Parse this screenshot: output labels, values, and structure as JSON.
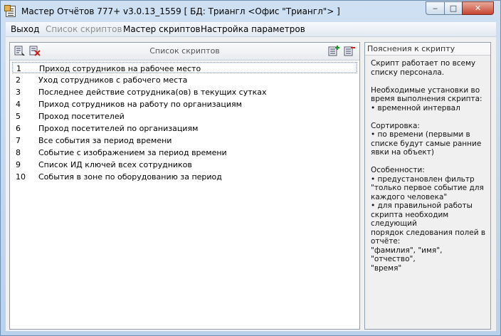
{
  "window": {
    "title": "Мастер Отчётов 777+ v3.0.13_1559 [ БД: Триангл <Офис \"Триангл\"> ]",
    "controls": {
      "minimize": "‒",
      "maximize": "□",
      "close": "✕"
    }
  },
  "menu": [
    {
      "label": "Выход",
      "enabled": true
    },
    {
      "label": "Список скриптов",
      "enabled": false
    },
    {
      "label": "Мастер скриптов",
      "enabled": true
    },
    {
      "label": "Настройка параметров",
      "enabled": true
    }
  ],
  "script_list": {
    "title": "Список скриптов",
    "toolbar_icons": [
      "list-edit-icon",
      "list-delete-icon",
      "add-script-icon",
      "remove-script-icon"
    ],
    "selected_index": 0,
    "items": [
      {
        "num": "1",
        "name": "Приход сотрудников на рабочее место"
      },
      {
        "num": "2",
        "name": "Уход сотрудников с рабочего места"
      },
      {
        "num": "3",
        "name": "Последнее действие сотрудника(ов) в текущих сутках"
      },
      {
        "num": "4",
        "name": "Приход сотрудников на работу по организациям"
      },
      {
        "num": "5",
        "name": "Проход посетителей"
      },
      {
        "num": "6",
        "name": "Проход посетителей по организациям"
      },
      {
        "num": "7",
        "name": "Все события за период времени"
      },
      {
        "num": "8",
        "name": "Событие с изображением за период времени"
      },
      {
        "num": "9",
        "name": "Список ИД ключей всех сотрудников"
      },
      {
        "num": "10",
        "name": "События в зоне по оборудованию за период"
      }
    ]
  },
  "notes_panel": {
    "title": "Пояснения к скрипту",
    "text": "Скрипт работает по всему\nсписку персонала.\n\nНеобходимые установки во\nвремя выполнения скрипта:\n• временной интервал\n\nСортировка:\n• по времени (первыми в\nсписке будут самые ранние\nявки на объект)\n\nОсобенности:\n• предустановлен фильтр\n\"только первое событие для\nкаждого человека\"\n• для правильной работы\nскрипта необходим\nследующий\nпорядок следования полей в\nотчёте:\n\"фамилия\", \"имя\", \"отчество\",\n\"время\""
  },
  "colors": {
    "title_bg": "#c3d7ee",
    "selection_border": "#7aa2d6",
    "close_button": "#c74530"
  }
}
